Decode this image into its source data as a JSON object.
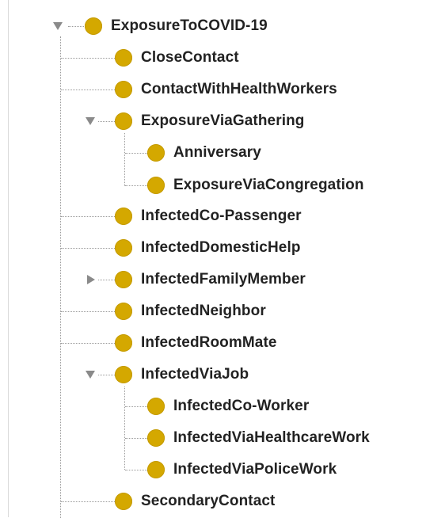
{
  "tree": {
    "root": {
      "label": "ExposureToCOVID-19",
      "state": "expanded"
    },
    "items": [
      {
        "label": "CloseContact"
      },
      {
        "label": "ContactWithHealthWorkers"
      },
      {
        "label": "ExposureViaGathering",
        "state": "expanded",
        "children": [
          {
            "label": "Anniversary"
          },
          {
            "label": "ExposureViaCongregation"
          }
        ]
      },
      {
        "label": "InfectedCo-Passenger"
      },
      {
        "label": "InfectedDomesticHelp"
      },
      {
        "label": "InfectedFamilyMember",
        "state": "collapsed"
      },
      {
        "label": "InfectedNeighbor"
      },
      {
        "label": "InfectedRoomMate"
      },
      {
        "label": "InfectedViaJob",
        "state": "expanded",
        "children": [
          {
            "label": "InfectedCo-Worker"
          },
          {
            "label": "InfectedViaHealthcareWork"
          },
          {
            "label": "InfectedViaPoliceWork"
          }
        ]
      },
      {
        "label": "SecondaryContact"
      }
    ]
  },
  "colors": {
    "class_icon": "#d4a800",
    "toggle": "#8a8a8a",
    "guide_line": "#9a9a9a"
  }
}
